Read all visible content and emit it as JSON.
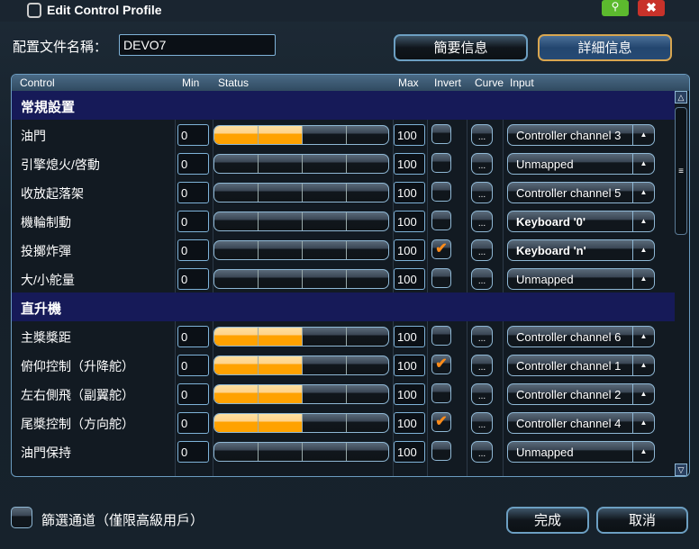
{
  "window": {
    "title": "Edit Control Profile"
  },
  "profile": {
    "label": "配置文件名稱：",
    "name": "DEVO7"
  },
  "tabs": [
    {
      "label": "簡要信息",
      "active": false
    },
    {
      "label": "詳細信息",
      "active": true
    }
  ],
  "columns": {
    "control": "Control",
    "min": "Min",
    "status": "Status",
    "max": "Max",
    "invert": "Invert",
    "curve": "Curve",
    "input": "Input"
  },
  "curve_label": "...",
  "sections": [
    {
      "title": "常規設置",
      "rows": [
        {
          "control": "油門",
          "min": "0",
          "max": "100",
          "status": 0.5,
          "invert": false,
          "input": "Controller channel 3",
          "bold": false
        },
        {
          "control": "引擎熄火/啓動",
          "min": "0",
          "max": "100",
          "status": 0,
          "invert": false,
          "input": "Unmapped",
          "bold": false
        },
        {
          "control": "收放起落架",
          "min": "0",
          "max": "100",
          "status": 0,
          "invert": false,
          "input": "Controller channel 5",
          "bold": false
        },
        {
          "control": "機輪制動",
          "min": "0",
          "max": "100",
          "status": 0,
          "invert": false,
          "input": "Keyboard '0'",
          "bold": true
        },
        {
          "control": "投擲炸彈",
          "min": "0",
          "max": "100",
          "status": 0,
          "invert": true,
          "input": "Keyboard 'n'",
          "bold": true
        },
        {
          "control": "大/小舵量",
          "min": "0",
          "max": "100",
          "status": 0,
          "invert": false,
          "input": "Unmapped",
          "bold": false
        }
      ]
    },
    {
      "title": "直升機",
      "rows": [
        {
          "control": "主槳槳距",
          "min": "0",
          "max": "100",
          "status": 0.5,
          "invert": false,
          "input": "Controller channel 6",
          "bold": false
        },
        {
          "control": "俯仰控制（升降舵）",
          "min": "0",
          "max": "100",
          "status": 0.5,
          "invert": true,
          "input": "Controller channel 1",
          "bold": false
        },
        {
          "control": "左右側飛（副翼舵）",
          "min": "0",
          "max": "100",
          "status": 0.5,
          "invert": false,
          "input": "Controller channel 2",
          "bold": false
        },
        {
          "control": "尾槳控制（方向舵）",
          "min": "0",
          "max": "100",
          "status": 0.5,
          "invert": true,
          "input": "Controller channel 4",
          "bold": false
        },
        {
          "control": "油門保持",
          "min": "0",
          "max": "100",
          "status": 0,
          "invert": false,
          "input": "Unmapped",
          "bold": false
        }
      ]
    }
  ],
  "footer": {
    "advanced_filter": "篩選通道（僅限高級用戶）",
    "done": "完成",
    "cancel": "取消"
  },
  "colors": {
    "accent": "#ffa200",
    "section_bg": "#161a58",
    "check": "#ff8c1a"
  }
}
